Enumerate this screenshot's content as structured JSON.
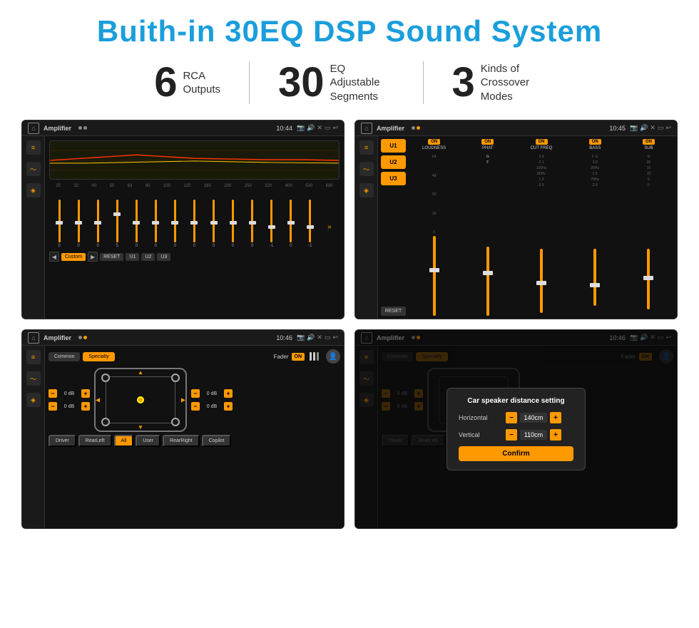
{
  "title": "Buith-in 30EQ DSP Sound System",
  "stats": [
    {
      "number": "6",
      "label": "RCA\nOutputs"
    },
    {
      "number": "30",
      "label": "EQ Adjustable\nSegments"
    },
    {
      "number": "3",
      "label": "Kinds of\nCrossover Modes"
    }
  ],
  "screens": [
    {
      "id": "eq-screen",
      "title": "Amplifier",
      "time": "10:44",
      "type": "eq"
    },
    {
      "id": "crossover-screen",
      "title": "Amplifier",
      "time": "10:45",
      "type": "crossover"
    },
    {
      "id": "fader-screen",
      "title": "Amplifier",
      "time": "10:46",
      "type": "fader"
    },
    {
      "id": "dialog-screen",
      "title": "Amplifier",
      "time": "10:46",
      "type": "dialog"
    }
  ],
  "eq": {
    "frequencies": [
      "25",
      "32",
      "40",
      "50",
      "63",
      "80",
      "100",
      "125",
      "160",
      "200",
      "250",
      "320",
      "400",
      "500",
      "630"
    ],
    "values": [
      "0",
      "0",
      "0",
      "5",
      "0",
      "0",
      "0",
      "0",
      "0",
      "0",
      "0",
      "-1",
      "0",
      "-1"
    ],
    "preset": "Custom",
    "buttons": [
      "RESET",
      "U1",
      "U2",
      "U3"
    ]
  },
  "crossover": {
    "channels": [
      {
        "id": "U1",
        "label": "U1"
      },
      {
        "id": "U2",
        "label": "U2"
      },
      {
        "id": "U3",
        "label": "U3"
      }
    ],
    "params": [
      {
        "name": "LOUDNESS",
        "on": true
      },
      {
        "name": "PHAT",
        "on": true
      },
      {
        "name": "CUT FREQ",
        "on": true
      },
      {
        "name": "BASS",
        "on": true
      },
      {
        "name": "SUB",
        "on": true
      }
    ]
  },
  "fader": {
    "tabs": [
      "Common",
      "Specialty"
    ],
    "activeTab": "Specialty",
    "faderLabel": "Fader",
    "faderOn": "ON",
    "dbValues": [
      "0 dB",
      "0 dB",
      "0 dB",
      "0 dB"
    ],
    "bottomButtons": [
      "Driver",
      "RearLeft",
      "All",
      "User",
      "RearRight",
      "Copilot"
    ]
  },
  "dialog": {
    "title": "Car speaker distance setting",
    "rows": [
      {
        "label": "Horizontal",
        "value": "140cm"
      },
      {
        "label": "Vertical",
        "value": "110cm"
      }
    ],
    "confirmLabel": "Confirm"
  },
  "accent": "#f90000",
  "accentOrange": "#ff9900"
}
